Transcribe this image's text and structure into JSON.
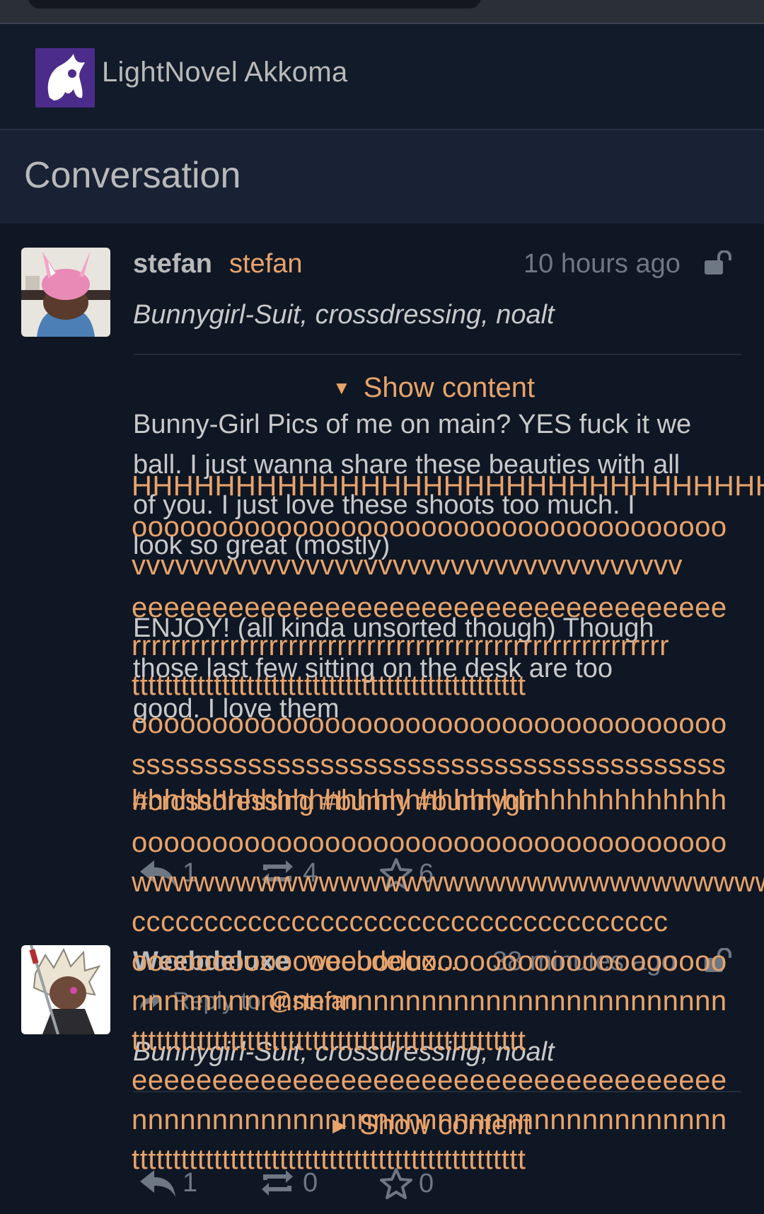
{
  "header": {
    "site_name": "LightNovel Akkoma"
  },
  "panel": {
    "title": "Conversation"
  },
  "posts": [
    {
      "display_name": "stefan",
      "handle": "stefan",
      "time": "10 hours ago",
      "subject": "Bunnygirl-Suit, crossdressing, noalt",
      "show_content": "Show content",
      "body_lines": [
        "Bunny-Girl Pics of me on main? YES fuck it we",
        "ball. I just wanna share these beauties with all",
        "of you. I just love these shoots too much. I",
        "look so great (mostly)",
        "",
        "ENJOY! (all kinda unsorted though) Though",
        "those last few sitting on the desk are too",
        "good. I love them",
        "",
        "#crossdressing #bunny #bunnygirl"
      ],
      "actions": {
        "replies": "1",
        "repeats": "4",
        "favorites": "6"
      }
    },
    {
      "display_name": "Weebdeluxe",
      "handle": "weebdelux...",
      "time": "38 minutes ago",
      "reply_to_label": "Reply to",
      "reply_to_user": "@stefan",
      "subject": "Bunnygirl-Suit, crossdressing, noalt",
      "show_content": "Show content",
      "actions": {
        "replies": "1",
        "repeats": "0",
        "favorites": "0"
      }
    }
  ],
  "overlay_rows": [
    "HHHHHHHHHHHHHHHHHHHHHHHHHHHHHHHHHHHHHHHHH",
    "ooooooooooooooooooooooooooooooooooooo",
    "vvvvvvvvvvvvvvvvvvvvvvvvvvvvvvvvvvvvvv",
    "eeeeeeeeeeeeeeeeeeeeeeeeeeeeeeeeeeeee",
    "rrrrrrrrrrrrrrrrrrrrrrrrrrrrrrrrrrrrrrrrrrrrrrrrrrrrrrr",
    "tttttttttttttttttttttttttttttttttttttttttttttttt",
    "ooooooooooooooooooooooooooooooooooooo",
    "sssssssssssssssssssssssssssssssssssssssss",
    "hhhhhhhhhhhhhhhhhhhhhhhhhhhhhhhhhhhhh",
    "ooooooooooooooooooooooooooooooooooooo",
    "wwwwwwwwwwwwwwwwwwwwwwwwwwwwwwwwwwww",
    "ccccccccccccccccccccccccccccccccccccc",
    "ooooooooooooooooooooooooooooooooooooo",
    "nnnnnnnnnnnnnnnnnnnnnnnnnnnnnnnnnnnnn",
    "tttttttttttttttttttttttttttttttttttttttttttttttt",
    "eeeeeeeeeeeeeeeeeeeeeeeeeeeeeeeeeeeee",
    "nnnnnnnnnnnnnnnnnnnnnnnnnnnnnnnnnnnnn",
    "tttttttttttttttttttttttttttttttttttttttttttttttt"
  ]
}
